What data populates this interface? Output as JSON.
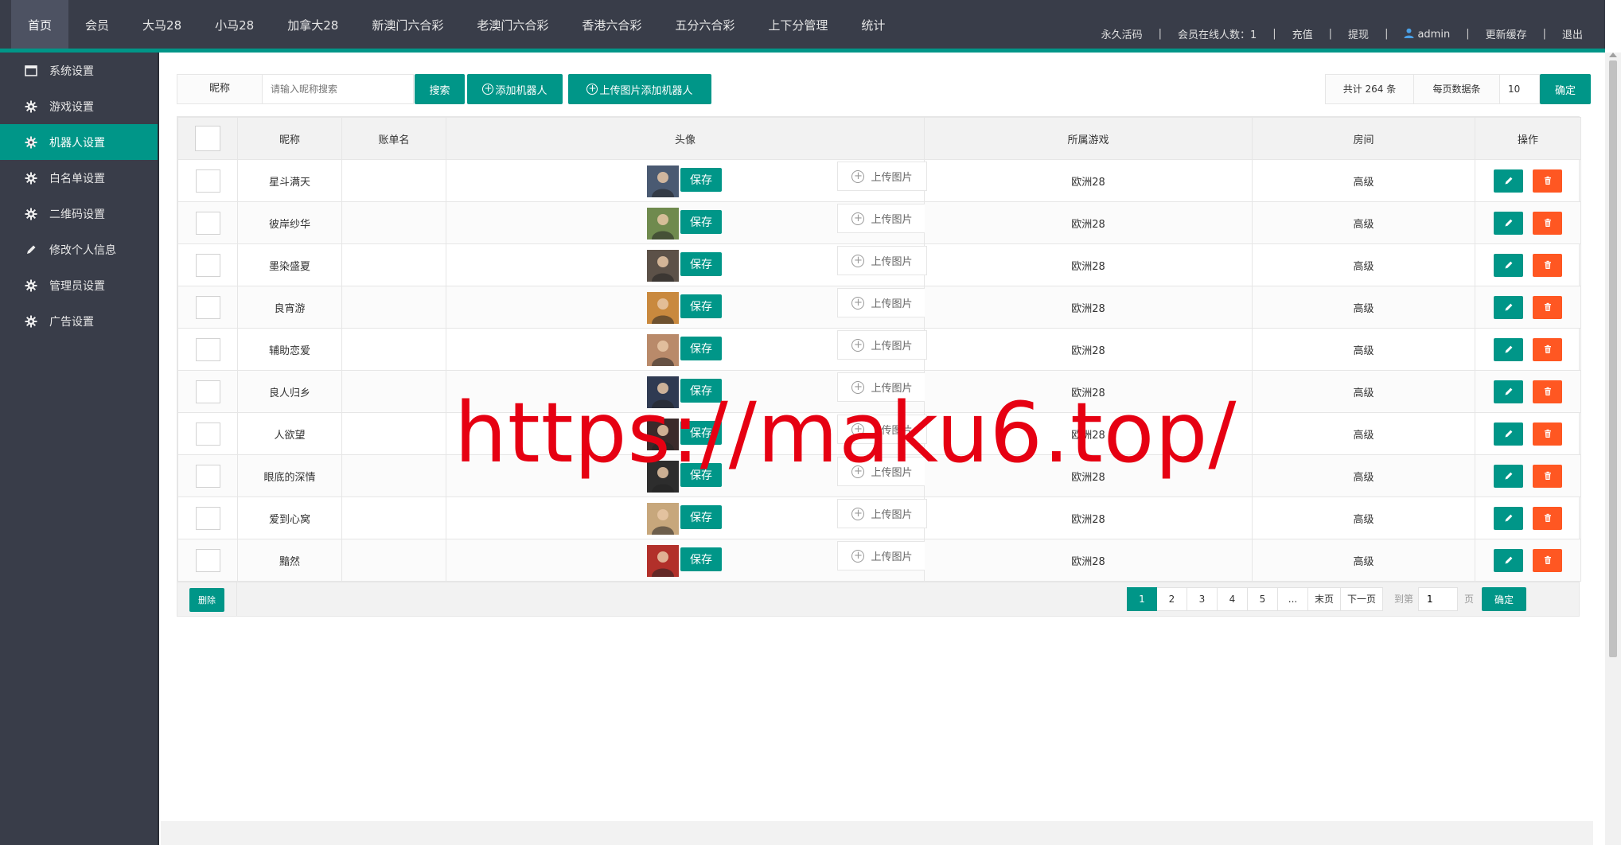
{
  "top_nav": [
    {
      "label": "首页",
      "active": true
    },
    {
      "label": "会员",
      "active": false
    },
    {
      "label": "大马28",
      "active": false
    },
    {
      "label": "小马28",
      "active": false
    },
    {
      "label": "加拿大28",
      "active": false
    },
    {
      "label": "新澳门六合彩",
      "active": false
    },
    {
      "label": "老澳门六合彩",
      "active": false
    },
    {
      "label": "香港六合彩",
      "active": false
    },
    {
      "label": "五分六合彩",
      "active": false
    },
    {
      "label": "上下分管理",
      "active": false
    },
    {
      "label": "统计",
      "active": false
    }
  ],
  "top_right": {
    "activation": "永久活码",
    "online": "会员在线人数：1",
    "recharge": "充值",
    "withdraw": "提现",
    "username": "admin",
    "clear_cache": "更新缓存",
    "logout": "退出",
    "separator": "|"
  },
  "sidebar": [
    {
      "label": "系统设置",
      "icon": "window-icon",
      "active": false
    },
    {
      "label": "游戏设置",
      "icon": "gear-icon",
      "active": false
    },
    {
      "label": "机器人设置",
      "icon": "gear-icon",
      "active": true
    },
    {
      "label": "白名单设置",
      "icon": "gear-icon",
      "active": false
    },
    {
      "label": "二维码设置",
      "icon": "gear-icon",
      "active": false
    },
    {
      "label": "修改个人信息",
      "icon": "pencil-icon",
      "active": false
    },
    {
      "label": "管理员设置",
      "icon": "gear-icon",
      "active": false
    },
    {
      "label": "广告设置",
      "icon": "gear-icon",
      "active": false
    }
  ],
  "toolbar": {
    "nickname_label": "昵称",
    "search_placeholder": "请输入昵称搜索",
    "search_button": "搜索",
    "add_robot_button": "添加机器人",
    "upload_add_button": "上传图片添加机器人",
    "total_label": "共计 264 条",
    "per_page_label": "每页数据条",
    "per_page_value": "10",
    "confirm_button": "确定"
  },
  "table": {
    "headers": [
      "",
      "昵称",
      "账单名",
      "头像",
      "所属游戏",
      "房间",
      "操作"
    ],
    "save_label": "保存",
    "upload_label": "上传图片",
    "rows": [
      {
        "nickname": "星斗满天",
        "account": "",
        "game": "欧洲28",
        "room": "高级",
        "avatar_color": "#4a5a72"
      },
      {
        "nickname": "彼岸纱华",
        "account": "",
        "game": "欧洲28",
        "room": "高级",
        "avatar_color": "#6f8a4e"
      },
      {
        "nickname": "墨染盛夏",
        "account": "",
        "game": "欧洲28",
        "room": "高级",
        "avatar_color": "#5c5148"
      },
      {
        "nickname": "良宵游",
        "account": "",
        "game": "欧洲28",
        "room": "高级",
        "avatar_color": "#c9893e"
      },
      {
        "nickname": "辅助恋爱",
        "account": "",
        "game": "欧洲28",
        "room": "高级",
        "avatar_color": "#b98a6a"
      },
      {
        "nickname": "良人归乡",
        "account": "",
        "game": "欧洲28",
        "room": "高级",
        "avatar_color": "#2f3a52"
      },
      {
        "nickname": "人欲望",
        "account": "",
        "game": "欧洲28",
        "room": "高级",
        "avatar_color": "#3b2a2a"
      },
      {
        "nickname": "眼底的深情",
        "account": "",
        "game": "欧洲28",
        "room": "高级",
        "avatar_color": "#2d2d2d"
      },
      {
        "nickname": "爱到心窝",
        "account": "",
        "game": "欧洲28",
        "room": "高级",
        "avatar_color": "#c7a77c"
      },
      {
        "nickname": "黯然",
        "account": "",
        "game": "欧洲28",
        "room": "高级",
        "avatar_color": "#b2302a"
      }
    ]
  },
  "footer": {
    "delete_button": "删除",
    "pages": [
      "1",
      "2",
      "3",
      "4",
      "5",
      "...",
      "末页",
      "下一页"
    ],
    "current_page": "1",
    "goto_label": "到第",
    "goto_value": "1",
    "goto_unit": "页",
    "goto_button": "确定"
  },
  "watermark": "https://maku6.top/",
  "colors": {
    "accent": "#009688",
    "danger": "#ff5722",
    "nav_bg": "#393d49",
    "watermark": "#e60012"
  }
}
